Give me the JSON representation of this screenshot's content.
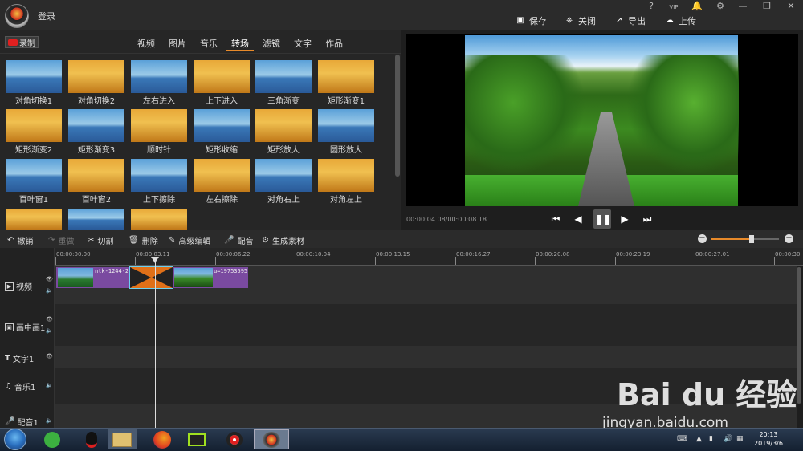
{
  "header": {
    "login_label": "登录",
    "window_icons": [
      "?",
      "VIP",
      "🔔",
      "⚙",
      "—",
      "❐",
      "✕"
    ],
    "actions": [
      {
        "label": "保存",
        "icon": "save-icon"
      },
      {
        "label": "关闭",
        "icon": "close-file-icon"
      },
      {
        "label": "导出",
        "icon": "export-icon"
      },
      {
        "label": "上传",
        "icon": "upload-icon"
      }
    ]
  },
  "left_panel": {
    "record_label": "录制",
    "tabs": [
      "视频",
      "图片",
      "音乐",
      "转场",
      "滤镜",
      "文字",
      "作品"
    ],
    "active_tab": "转场",
    "transitions": [
      "对角切换1",
      "对角切换2",
      "左右进入",
      "上下进入",
      "三角渐变",
      "矩形渐变1",
      "矩形渐变2",
      "矩形渐变3",
      "顺时针",
      "矩形收缩",
      "矩形放大",
      "圆形放大",
      "百叶窗1",
      "百叶窗2",
      "上下擦除",
      "左右擦除",
      "对角右上",
      "对角左上",
      "",
      "",
      ""
    ]
  },
  "preview": {
    "timecode": "00:00:04.08/00:00:08.18"
  },
  "edit_toolbar": {
    "items": [
      {
        "label": "撤销",
        "icon": "undo-icon"
      },
      {
        "label": "重做",
        "icon": "redo-icon"
      },
      {
        "label": "切割",
        "icon": "scissors-icon"
      },
      {
        "label": "删除",
        "icon": "trash-icon"
      },
      {
        "label": "高级编辑",
        "icon": "pencil-icon"
      },
      {
        "label": "配音",
        "icon": "microphone-icon"
      },
      {
        "label": "生成素材",
        "icon": "gear-icon"
      }
    ],
    "zoom_level": 0.6
  },
  "timeline": {
    "ruler": [
      "00:00:00.00",
      "00:00:03.11",
      "00:00:06.22",
      "00:00:10.04",
      "00:00:13.15",
      "00:00:16.27",
      "00:00:20.08",
      "00:00:23.19",
      "00:00:27.01",
      "00:00:30"
    ],
    "tracks": [
      {
        "label": "视频",
        "icon": "video-track-icon"
      },
      {
        "label": "画中画1",
        "icon": "pip-track-icon"
      },
      {
        "label": "文字1",
        "icon": "text-track-icon"
      },
      {
        "label": "音乐1",
        "icon": "music-track-icon"
      },
      {
        "label": "配音1",
        "icon": "voice-track-icon"
      }
    ],
    "clip1_label": "ntk-1244-2",
    "clip2_label": "u=19753595"
  },
  "taskbar": {
    "time": "20:13",
    "date": "2019/3/6"
  },
  "watermark": {
    "logo": "Bai du 经验",
    "url": "jingyan.baidu.com"
  }
}
